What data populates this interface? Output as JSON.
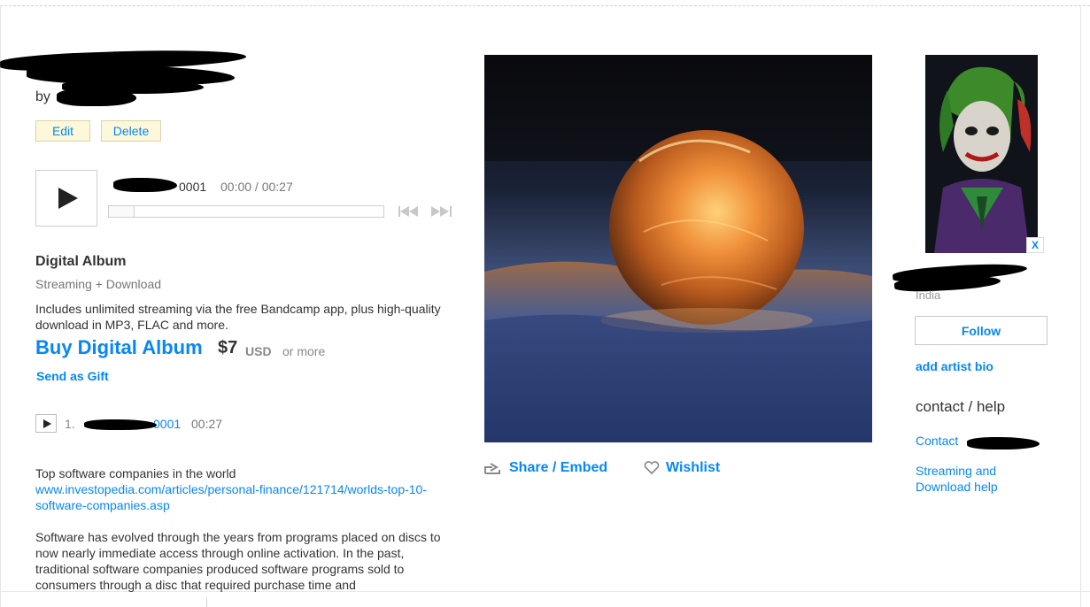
{
  "album": {
    "by_prefix": "by",
    "edit_label": "Edit",
    "delete_label": "Delete"
  },
  "player": {
    "track_title_suffix": "0001",
    "time": "00:00 / 00:27",
    "progress": 0
  },
  "purchase": {
    "format_title": "Digital Album",
    "format_subtitle": "Streaming + Download",
    "description": "Includes unlimited streaming via the free Bandcamp app, plus high-quality download in MP3, FLAC and more.",
    "buy_label": "Buy Digital Album",
    "price": "$7",
    "currency": "USD",
    "or_more": "or more",
    "gift_label": "Send as Gift"
  },
  "tracklist": [
    {
      "num": "1.",
      "title_suffix": "0001",
      "duration": "00:27"
    }
  ],
  "about": {
    "heading_line": "Top software companies in the world",
    "link": "www.investopedia.com/articles/personal-finance/121714/worlds-top-10-software-companies.asp",
    "body": "Software has evolved through the years from programs placed on discs to now nearly immediate access through online activation. In the past, traditional software companies produced software programs sold to consumers through a disc that required purchase time and"
  },
  "actions": {
    "share_label": "Share / Embed",
    "wishlist_label": "Wishlist"
  },
  "artist": {
    "close_label": "X",
    "location": "India",
    "follow_label": "Follow",
    "bio_label": "add artist bio",
    "contact_heading": "contact / help",
    "contact_prefix": "Contact",
    "help_label": "Streaming and Download help"
  },
  "colors": {
    "link": "#0687f5",
    "button_bg": "#fdf8d9",
    "text": "#333333",
    "muted": "#777777"
  },
  "icons": [
    "play-icon",
    "previous-track-icon",
    "next-track-icon",
    "share-icon",
    "heart-icon"
  ]
}
